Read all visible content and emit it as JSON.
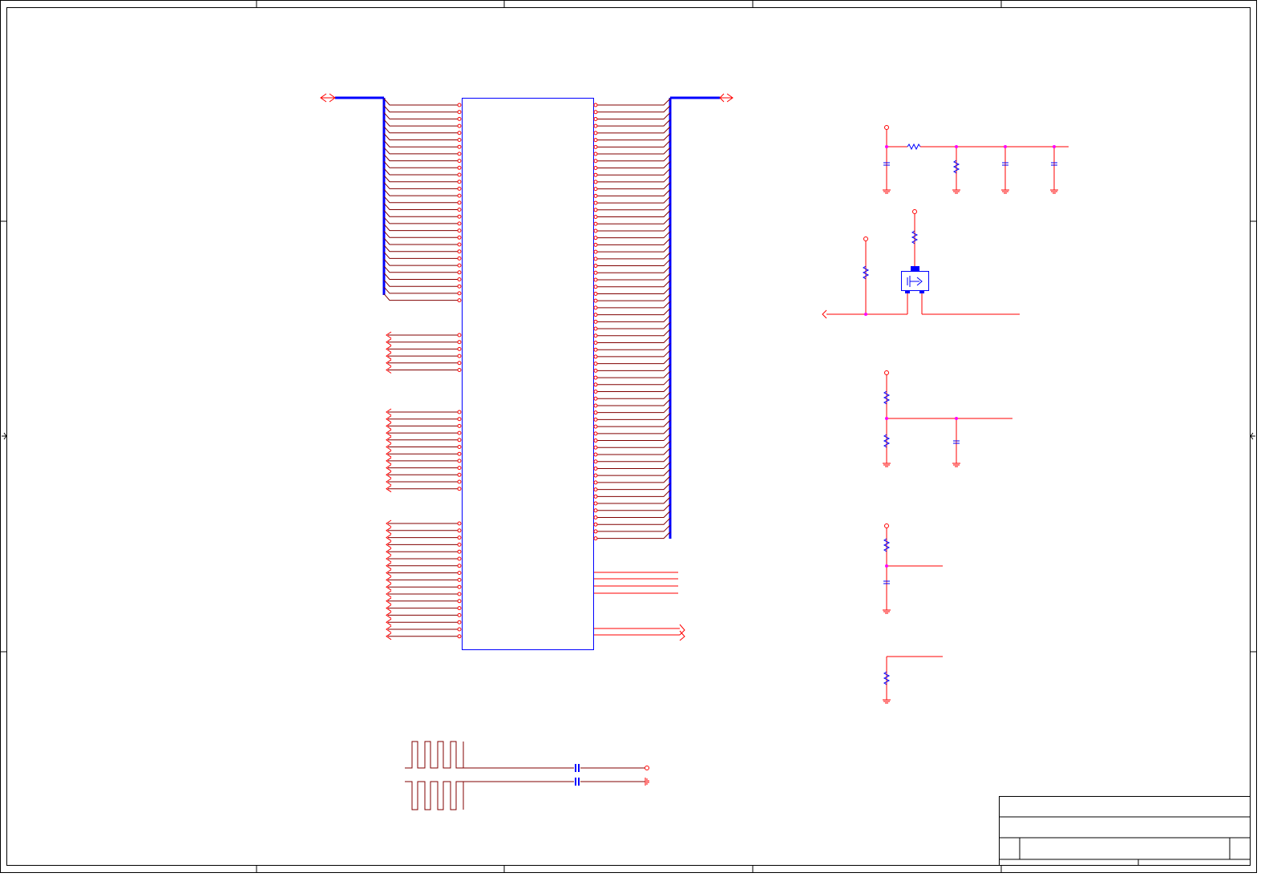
{
  "sheet": {
    "colors": {
      "wire": "#ff0000",
      "wire_dark": "#800000",
      "bus": "#0000ff",
      "component": "#0000ff",
      "junction": "#ff00ff",
      "border": "#000000"
    },
    "title_block": {
      "title": "",
      "subtitle": "",
      "size": "",
      "document_number": "",
      "revision": "",
      "date": "",
      "sheet": ""
    },
    "symbols": [
      "main-ic",
      "address-bus-left",
      "data-bus-right",
      "resistor-icon",
      "capacitor-icon",
      "ground-icon",
      "mosfet-icon",
      "pcb-antenna-icon",
      "off-page-connector-icon"
    ]
  }
}
